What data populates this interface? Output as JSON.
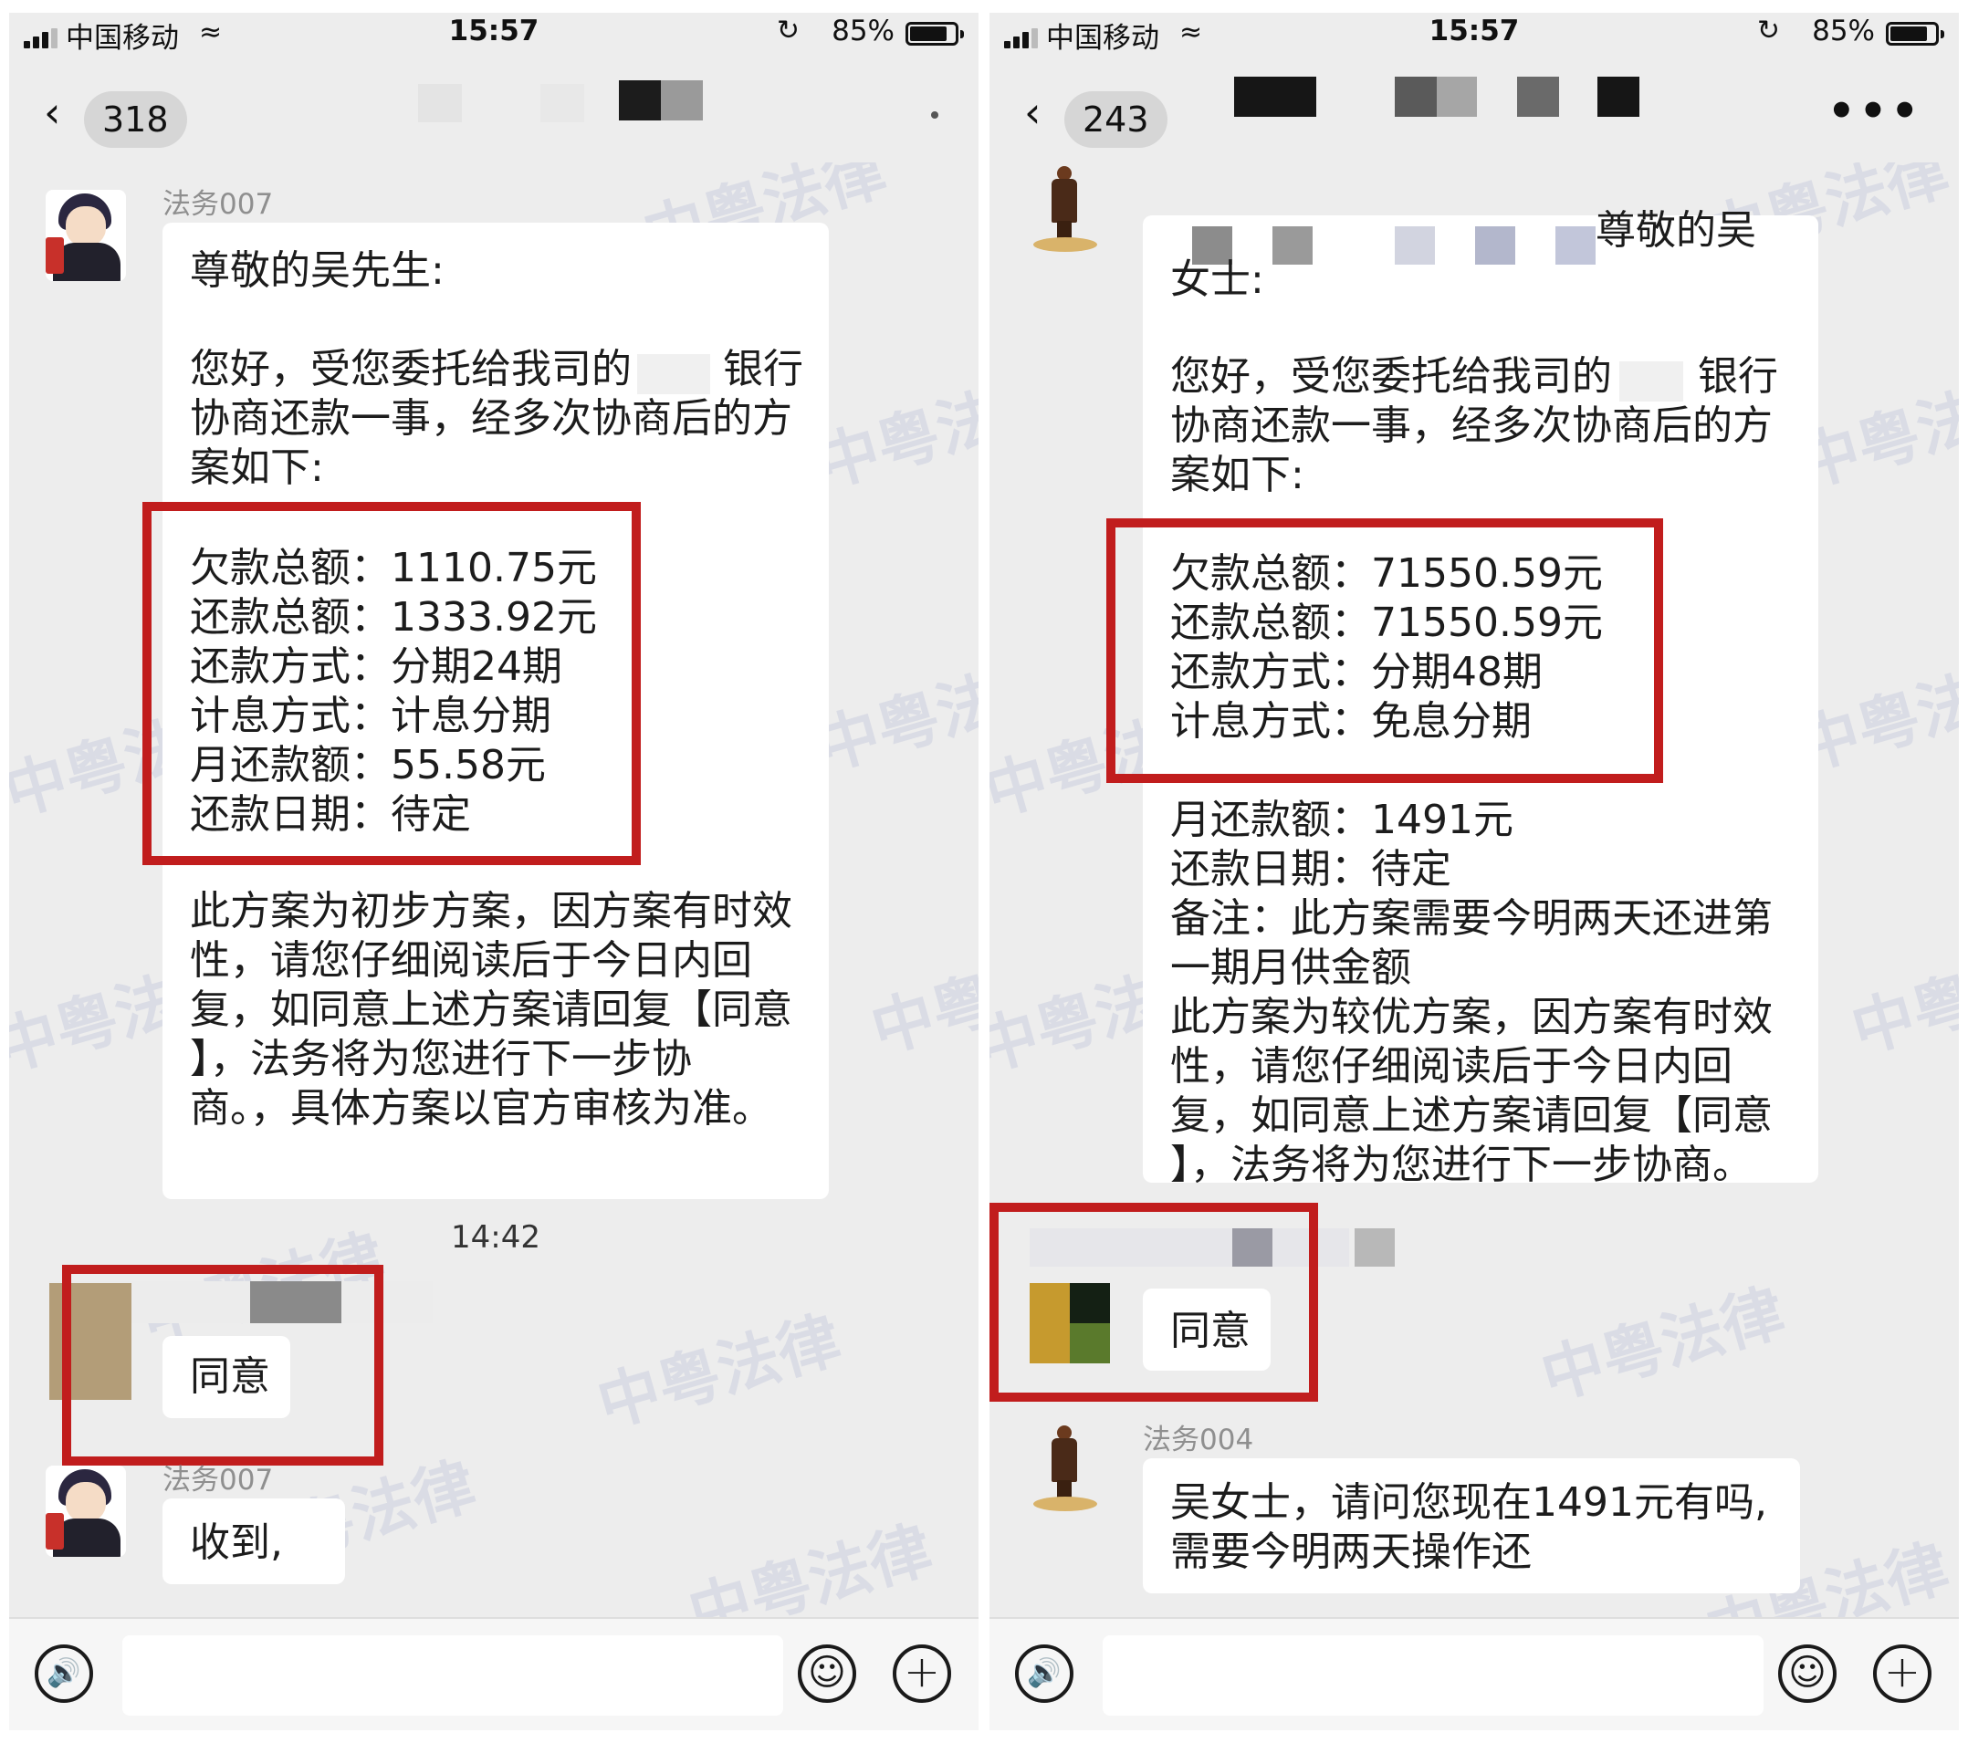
{
  "left_phone": {
    "status": {
      "carrier": "中国移动",
      "time": "15:57",
      "battery": "85%",
      "battery_level": 0.85
    },
    "nav": {
      "unread_count": "318"
    },
    "messages": {
      "sender_1": "法务007",
      "greeting": "尊敬的吴先生:",
      "intro": [
        "您好，受您委托给我司的",
        "银行",
        "协商还款一事，经多次协商后的方",
        "案如下:"
      ],
      "plan": [
        "欠款总额：1110.75元",
        "还款总额：1333.92元",
        "还款方式：分期24期",
        "计息方式：计息分期",
        "月还款额：55.58元",
        "还款日期：待定"
      ],
      "notes": [
        "此方案为初步方案，因方案有时效",
        "性，请您仔细阅读后于今日内回",
        "复，如同意上述方案请回复【同意",
        "】，法务将为您进行下一步协",
        "商。，具体方案以官方审核为准。"
      ],
      "time": "14:42",
      "reply": "同意",
      "sender_2": "法务007",
      "ack": "收到,"
    }
  },
  "right_phone": {
    "status": {
      "carrier": "中国移动",
      "time": "15:57",
      "battery": "85%",
      "battery_level": 0.85
    },
    "nav": {
      "unread_count": "243",
      "more": "•••"
    },
    "messages": {
      "greeting_tail": "尊敬的吴",
      "greeting_line2": "女士:",
      "intro": [
        "您好，受您委托给我司的",
        "银行",
        "协商还款一事，经多次协商后的方",
        "案如下:"
      ],
      "plan": [
        "欠款总额：71550.59元",
        "还款总额：71550.59元",
        "还款方式：分期48期",
        "计息方式：免息分期"
      ],
      "after_plan": [
        "月还款额：1491元",
        "还款日期：待定",
        "备注：此方案需要今明两天还进第",
        "一期月供金额",
        "此方案为较优方案，因方案有时效",
        "性，请您仔细阅读后于今日内回",
        "复，如同意上述方案请回复【同意",
        "】，法务将为您进行下一步协商。"
      ],
      "reply": "同意",
      "sender_2": "法务004",
      "follow_up": [
        "吴女士，请问您现在1491元有吗,",
        "需要今明两天操作还"
      ]
    }
  },
  "watermark_text": "中粤法律",
  "colors": {
    "highlight_border": "#c11d1d",
    "chat_bg": "#ededed",
    "bubble": "#ffffff"
  }
}
